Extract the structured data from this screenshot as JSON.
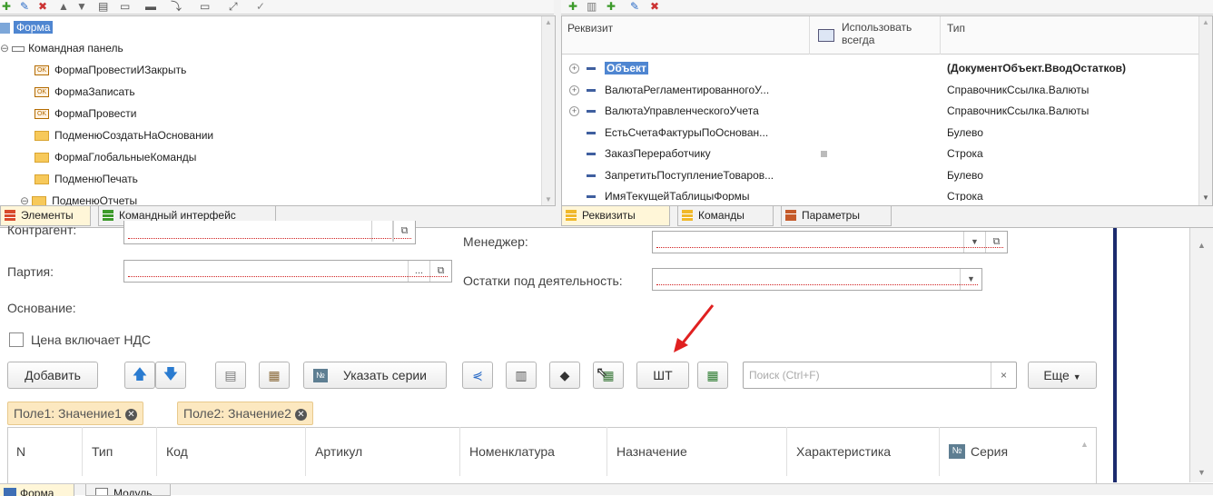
{
  "elements_tree": {
    "root": "Форма",
    "items": [
      {
        "label": "Командная панель"
      },
      {
        "label": "ФормаПровестиИЗакрыть",
        "badge": "OK"
      },
      {
        "label": "ФормаЗаписать",
        "badge": "OK"
      },
      {
        "label": "ФормаПровести",
        "badge": "OK"
      },
      {
        "label": "ПодменюСоздатьНаОсновании"
      },
      {
        "label": "ФормаГлобальныеКоманды"
      },
      {
        "label": "ПодменюПечать"
      },
      {
        "label": "ПодменюОтчеты"
      }
    ],
    "tabs": [
      "Элементы",
      "Командный интерфейс"
    ]
  },
  "attributes": {
    "columns": [
      "Реквизит",
      "Использовать всегда",
      "Тип"
    ],
    "rows": [
      {
        "name": "Объект",
        "type": "(ДокументОбъект.ВводОстатков)",
        "expand": true
      },
      {
        "name": "ВалютаРегламентированногоУ...",
        "type": "СправочникСсылка.Валюты",
        "expand": true
      },
      {
        "name": "ВалютаУправленческогоУчета",
        "type": "СправочникСсылка.Валюты",
        "expand": true
      },
      {
        "name": "ЕстьСчетаФактурыПоОснован...",
        "type": "Булево"
      },
      {
        "name": "ЗаказПереработчику",
        "type": "Строка",
        "checkbox": true
      },
      {
        "name": "ЗапретитьПоступлениеТоваров...",
        "type": "Булево"
      },
      {
        "name": "ИмяТекущейТаблицыФормы",
        "type": "Строка"
      }
    ],
    "tabs": [
      "Реквизиты",
      "Команды",
      "Параметры"
    ]
  },
  "form": {
    "kontragent": "Контрагент:",
    "partiya": "Партия:",
    "osnovanie": "Основание:",
    "nds": "Цена включает НДС",
    "manager": "Менеджер:",
    "ostatki": "Остатки под деятельность:",
    "dots": "...",
    "add": "Добавить",
    "series": "Указать серии",
    "sht": "ШТ",
    "search_placeholder": "Поиск (Ctrl+F)",
    "more": "Еще",
    "chip1": "Поле1: Значение1",
    "chip2": "Поле2: Значение2",
    "table_headers": [
      "N",
      "Тип",
      "Код",
      "Артикул",
      "Номенклатура",
      "Назначение",
      "Характеристика",
      "Серия"
    ]
  },
  "bottom_tabs": [
    "Форма",
    "Модуль"
  ],
  "colors": {
    "accent": "#3f5f9f",
    "tab_active": "#fff6d8",
    "chip": "#fce8c0",
    "arrow": "#e02020"
  }
}
